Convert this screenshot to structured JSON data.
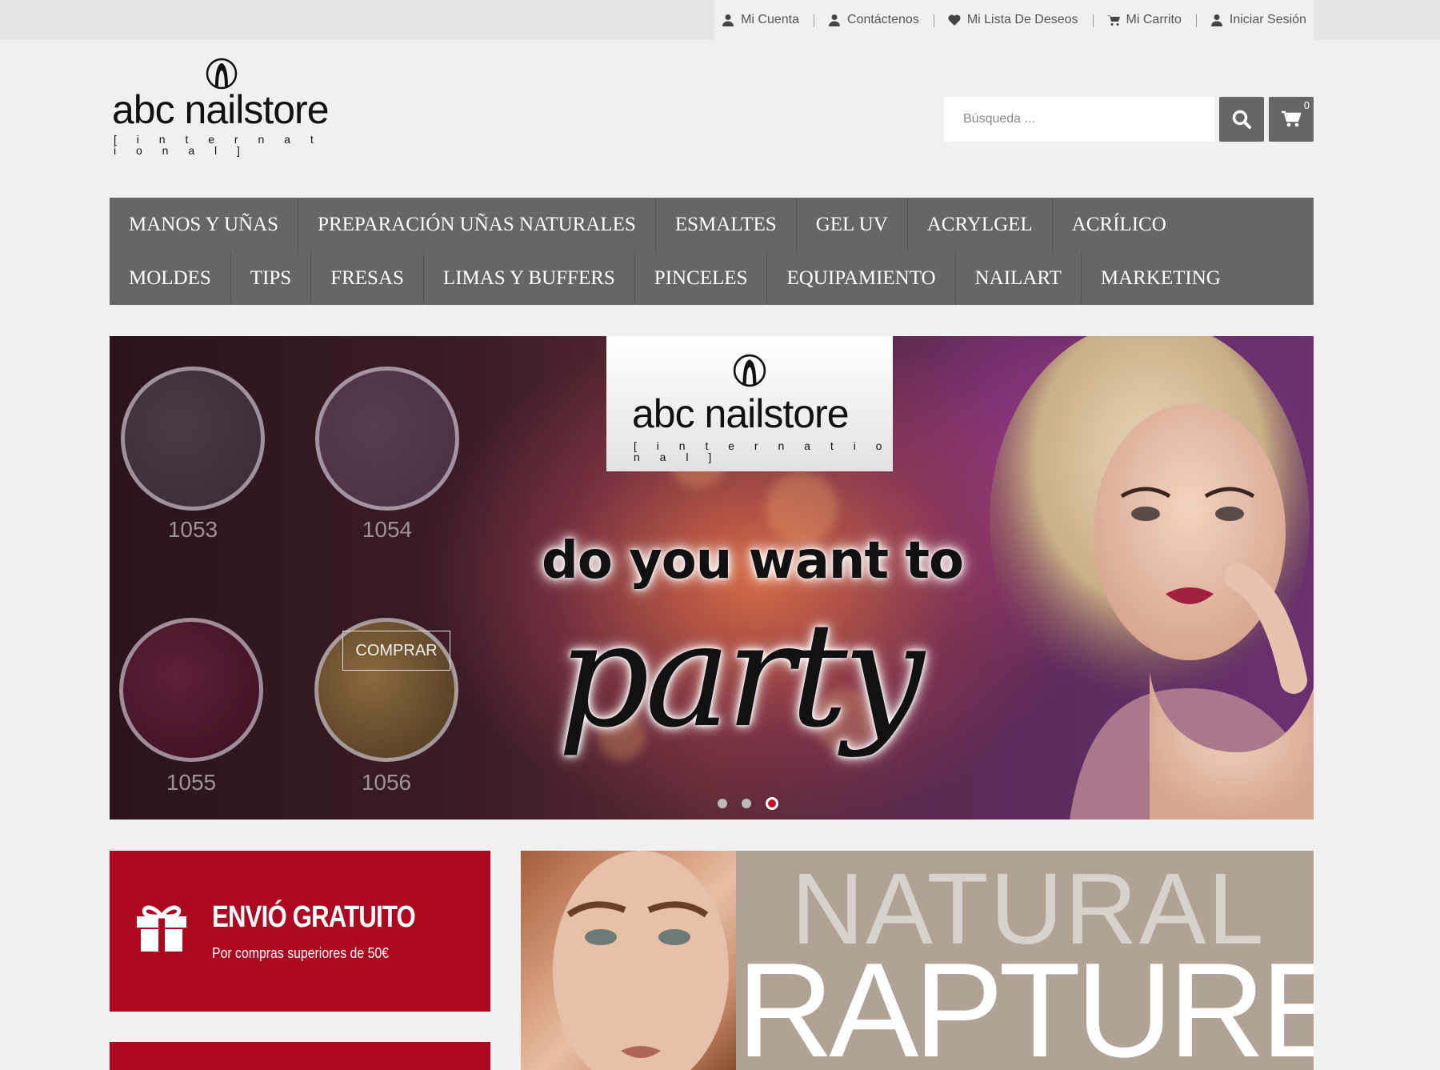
{
  "toplinks": {
    "account": "Mi Cuenta",
    "contact": "Contáctenos",
    "wishlist": "Mi Lista De Deseos",
    "cart": "Mi Carrito",
    "login": "Iniciar Sesión"
  },
  "logo": {
    "brand": "abc nailstore",
    "subtitle": "[ i n t e r n a t i o n a l ]"
  },
  "search": {
    "placeholder": "Búsqueda ...",
    "cart_count": "0"
  },
  "nav": {
    "row1": [
      "MANOS Y UÑAS",
      "PREPARACIÓN UÑAS NATURALES",
      "ESMALTES",
      "GEL UV",
      "ACRYLGEL",
      "ACRÍLICO"
    ],
    "row2": [
      "MOLDES",
      "TIPS",
      "FRESAS",
      "LIMAS Y BUFFERS",
      "PINCELES",
      "EQUIPAMIENTO",
      "NAILART",
      "MARKETING"
    ]
  },
  "hero": {
    "swatches": [
      "1053",
      "1054",
      "1055",
      "1056"
    ],
    "buy_label": "COMPRAR",
    "logo_brand": "abc nailstore",
    "logo_subtitle": "[ i n t e r n a t i o n a l ]",
    "headline": "do you want to",
    "script": "party",
    "slide_count": 3,
    "active_slide": 3
  },
  "shipping": {
    "title": "ENVIÓ GRATUITO",
    "subtitle": "Por compras superiores de 50€"
  },
  "promo": {
    "line1": "NATURAL",
    "line2": "RAPTURE"
  },
  "colors": {
    "accent_red": "#ac0820",
    "nav_gray": "#666666"
  }
}
